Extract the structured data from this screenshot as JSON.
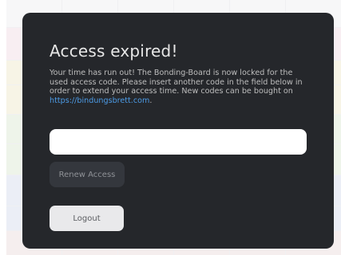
{
  "modal": {
    "title": "Access expired!",
    "message_text": "Your time has run out! The Bonding-Board is now locked for the used access code. Please insert another code in the field below in order to extend your access time. New codes can be bought on ",
    "message_link": "https://bindungsbrett.com",
    "message_end": ".",
    "code_input_value": "",
    "renew_label": "Renew Access",
    "logout_label": "Logout"
  }
}
